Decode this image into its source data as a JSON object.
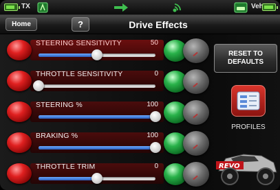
{
  "status": {
    "tx_label": "TX",
    "veh_label": "Veh",
    "tx_battery_level": 0.85,
    "veh_battery_level": 0.9
  },
  "header": {
    "home_label": "Home",
    "help_label": "?",
    "title": "Drive Effects"
  },
  "sliders": [
    {
      "label": "STEERING SENSITIVITY",
      "value": "50",
      "fraction": 0.5,
      "highlighted": true
    },
    {
      "label": "THROTTLE SENSITIVITY",
      "value": "0",
      "fraction": 0.0,
      "highlighted": false
    },
    {
      "label": "STEERING %",
      "value": "100",
      "fraction": 1.0,
      "highlighted": false
    },
    {
      "label": "BRAKING %",
      "value": "100",
      "fraction": 1.0,
      "highlighted": false
    },
    {
      "label": "THROTTLE TRIM",
      "value": "0",
      "fraction": 0.5,
      "highlighted": false
    }
  ],
  "side": {
    "reset_line1": "RESET TO",
    "reset_line2": "DEFAULTS",
    "profiles_label": "PROFILES"
  },
  "colors": {
    "accent_red": "#e02020",
    "accent_green": "#29b24a",
    "slider_blue": "#2b5fc0",
    "battery_green": "#7be04a"
  }
}
